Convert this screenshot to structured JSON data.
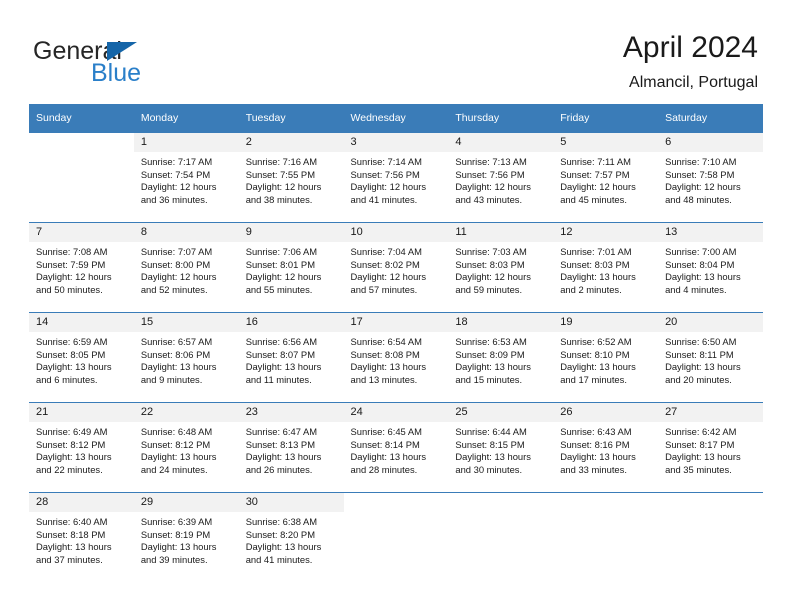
{
  "brand": {
    "name_top": "General",
    "name_bottom": "Blue",
    "color_dark": "#262626",
    "color_blue": "#2a7fc9",
    "triangle_color": "#1565a8"
  },
  "header": {
    "title": "April 2024",
    "subtitle": "Almancil, Portugal"
  },
  "theme": {
    "header_bg": "#3a7cb8",
    "header_text": "#ffffff",
    "daynum_bg": "#f2f2f2",
    "grid_line": "#3a7cb8"
  },
  "weekday_headers": [
    "Sunday",
    "Monday",
    "Tuesday",
    "Wednesday",
    "Thursday",
    "Friday",
    "Saturday"
  ],
  "weeks": [
    [
      {
        "day": "",
        "sunrise": "",
        "sunset": "",
        "daylight_line1": "",
        "daylight_line2": "",
        "empty": true
      },
      {
        "day": "1",
        "sunrise": "Sunrise: 7:17 AM",
        "sunset": "Sunset: 7:54 PM",
        "daylight_line1": "Daylight: 12 hours",
        "daylight_line2": "and 36 minutes."
      },
      {
        "day": "2",
        "sunrise": "Sunrise: 7:16 AM",
        "sunset": "Sunset: 7:55 PM",
        "daylight_line1": "Daylight: 12 hours",
        "daylight_line2": "and 38 minutes."
      },
      {
        "day": "3",
        "sunrise": "Sunrise: 7:14 AM",
        "sunset": "Sunset: 7:56 PM",
        "daylight_line1": "Daylight: 12 hours",
        "daylight_line2": "and 41 minutes."
      },
      {
        "day": "4",
        "sunrise": "Sunrise: 7:13 AM",
        "sunset": "Sunset: 7:56 PM",
        "daylight_line1": "Daylight: 12 hours",
        "daylight_line2": "and 43 minutes."
      },
      {
        "day": "5",
        "sunrise": "Sunrise: 7:11 AM",
        "sunset": "Sunset: 7:57 PM",
        "daylight_line1": "Daylight: 12 hours",
        "daylight_line2": "and 45 minutes."
      },
      {
        "day": "6",
        "sunrise": "Sunrise: 7:10 AM",
        "sunset": "Sunset: 7:58 PM",
        "daylight_line1": "Daylight: 12 hours",
        "daylight_line2": "and 48 minutes."
      }
    ],
    [
      {
        "day": "7",
        "sunrise": "Sunrise: 7:08 AM",
        "sunset": "Sunset: 7:59 PM",
        "daylight_line1": "Daylight: 12 hours",
        "daylight_line2": "and 50 minutes."
      },
      {
        "day": "8",
        "sunrise": "Sunrise: 7:07 AM",
        "sunset": "Sunset: 8:00 PM",
        "daylight_line1": "Daylight: 12 hours",
        "daylight_line2": "and 52 minutes."
      },
      {
        "day": "9",
        "sunrise": "Sunrise: 7:06 AM",
        "sunset": "Sunset: 8:01 PM",
        "daylight_line1": "Daylight: 12 hours",
        "daylight_line2": "and 55 minutes."
      },
      {
        "day": "10",
        "sunrise": "Sunrise: 7:04 AM",
        "sunset": "Sunset: 8:02 PM",
        "daylight_line1": "Daylight: 12 hours",
        "daylight_line2": "and 57 minutes."
      },
      {
        "day": "11",
        "sunrise": "Sunrise: 7:03 AM",
        "sunset": "Sunset: 8:03 PM",
        "daylight_line1": "Daylight: 12 hours",
        "daylight_line2": "and 59 minutes."
      },
      {
        "day": "12",
        "sunrise": "Sunrise: 7:01 AM",
        "sunset": "Sunset: 8:03 PM",
        "daylight_line1": "Daylight: 13 hours",
        "daylight_line2": "and 2 minutes."
      },
      {
        "day": "13",
        "sunrise": "Sunrise: 7:00 AM",
        "sunset": "Sunset: 8:04 PM",
        "daylight_line1": "Daylight: 13 hours",
        "daylight_line2": "and 4 minutes."
      }
    ],
    [
      {
        "day": "14",
        "sunrise": "Sunrise: 6:59 AM",
        "sunset": "Sunset: 8:05 PM",
        "daylight_line1": "Daylight: 13 hours",
        "daylight_line2": "and 6 minutes."
      },
      {
        "day": "15",
        "sunrise": "Sunrise: 6:57 AM",
        "sunset": "Sunset: 8:06 PM",
        "daylight_line1": "Daylight: 13 hours",
        "daylight_line2": "and 9 minutes."
      },
      {
        "day": "16",
        "sunrise": "Sunrise: 6:56 AM",
        "sunset": "Sunset: 8:07 PM",
        "daylight_line1": "Daylight: 13 hours",
        "daylight_line2": "and 11 minutes."
      },
      {
        "day": "17",
        "sunrise": "Sunrise: 6:54 AM",
        "sunset": "Sunset: 8:08 PM",
        "daylight_line1": "Daylight: 13 hours",
        "daylight_line2": "and 13 minutes."
      },
      {
        "day": "18",
        "sunrise": "Sunrise: 6:53 AM",
        "sunset": "Sunset: 8:09 PM",
        "daylight_line1": "Daylight: 13 hours",
        "daylight_line2": "and 15 minutes."
      },
      {
        "day": "19",
        "sunrise": "Sunrise: 6:52 AM",
        "sunset": "Sunset: 8:10 PM",
        "daylight_line1": "Daylight: 13 hours",
        "daylight_line2": "and 17 minutes."
      },
      {
        "day": "20",
        "sunrise": "Sunrise: 6:50 AM",
        "sunset": "Sunset: 8:11 PM",
        "daylight_line1": "Daylight: 13 hours",
        "daylight_line2": "and 20 minutes."
      }
    ],
    [
      {
        "day": "21",
        "sunrise": "Sunrise: 6:49 AM",
        "sunset": "Sunset: 8:12 PM",
        "daylight_line1": "Daylight: 13 hours",
        "daylight_line2": "and 22 minutes."
      },
      {
        "day": "22",
        "sunrise": "Sunrise: 6:48 AM",
        "sunset": "Sunset: 8:12 PM",
        "daylight_line1": "Daylight: 13 hours",
        "daylight_line2": "and 24 minutes."
      },
      {
        "day": "23",
        "sunrise": "Sunrise: 6:47 AM",
        "sunset": "Sunset: 8:13 PM",
        "daylight_line1": "Daylight: 13 hours",
        "daylight_line2": "and 26 minutes."
      },
      {
        "day": "24",
        "sunrise": "Sunrise: 6:45 AM",
        "sunset": "Sunset: 8:14 PM",
        "daylight_line1": "Daylight: 13 hours",
        "daylight_line2": "and 28 minutes."
      },
      {
        "day": "25",
        "sunrise": "Sunrise: 6:44 AM",
        "sunset": "Sunset: 8:15 PM",
        "daylight_line1": "Daylight: 13 hours",
        "daylight_line2": "and 30 minutes."
      },
      {
        "day": "26",
        "sunrise": "Sunrise: 6:43 AM",
        "sunset": "Sunset: 8:16 PM",
        "daylight_line1": "Daylight: 13 hours",
        "daylight_line2": "and 33 minutes."
      },
      {
        "day": "27",
        "sunrise": "Sunrise: 6:42 AM",
        "sunset": "Sunset: 8:17 PM",
        "daylight_line1": "Daylight: 13 hours",
        "daylight_line2": "and 35 minutes."
      }
    ],
    [
      {
        "day": "28",
        "sunrise": "Sunrise: 6:40 AM",
        "sunset": "Sunset: 8:18 PM",
        "daylight_line1": "Daylight: 13 hours",
        "daylight_line2": "and 37 minutes."
      },
      {
        "day": "29",
        "sunrise": "Sunrise: 6:39 AM",
        "sunset": "Sunset: 8:19 PM",
        "daylight_line1": "Daylight: 13 hours",
        "daylight_line2": "and 39 minutes."
      },
      {
        "day": "30",
        "sunrise": "Sunrise: 6:38 AM",
        "sunset": "Sunset: 8:20 PM",
        "daylight_line1": "Daylight: 13 hours",
        "daylight_line2": "and 41 minutes."
      },
      {
        "day": "",
        "sunrise": "",
        "sunset": "",
        "daylight_line1": "",
        "daylight_line2": "",
        "empty": true
      },
      {
        "day": "",
        "sunrise": "",
        "sunset": "",
        "daylight_line1": "",
        "daylight_line2": "",
        "empty": true
      },
      {
        "day": "",
        "sunrise": "",
        "sunset": "",
        "daylight_line1": "",
        "daylight_line2": "",
        "empty": true
      },
      {
        "day": "",
        "sunrise": "",
        "sunset": "",
        "daylight_line1": "",
        "daylight_line2": "",
        "empty": true
      }
    ]
  ]
}
